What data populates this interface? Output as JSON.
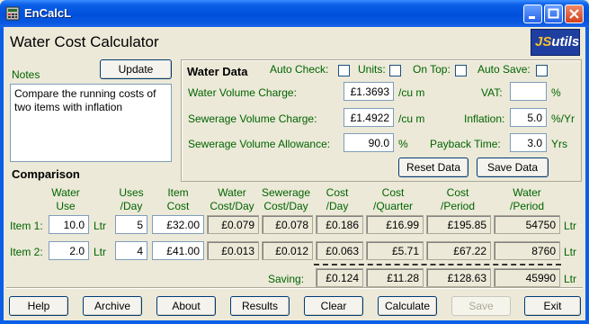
{
  "window": {
    "title": "EnCalcL"
  },
  "app": {
    "title": "Water Cost Calculator",
    "logo_j": "JS",
    "logo_rest": "utils"
  },
  "notes": {
    "label": "Notes",
    "update_label": "Update",
    "text": "Compare the running costs of two items with inflation"
  },
  "water_data": {
    "heading": "Water Data",
    "auto_check": "Auto Check:",
    "units": "Units:",
    "on_top": "On Top:",
    "auto_save": "Auto Save:",
    "water_charge_label": "Water Volume Charge:",
    "water_charge": "£1.3693",
    "water_charge_unit": "/cu m",
    "sewer_charge_label": "Sewerage Volume Charge:",
    "sewer_charge": "£1.4922",
    "sewer_charge_unit": "/cu m",
    "sewer_allow_label": "Sewerage Volume Allowance:",
    "sewer_allow": "90.0",
    "sewer_allow_unit": "%",
    "vat_label": "VAT:",
    "vat": "",
    "vat_unit": "%",
    "inflation_label": "Inflation:",
    "inflation": "5.0",
    "inflation_unit": "%/Yr",
    "payback_label": "Payback Time:",
    "payback": "3.0",
    "payback_unit": "Yrs",
    "reset_label": "Reset Data",
    "save_label": "Save Data"
  },
  "comparison": {
    "heading": "Comparison",
    "headers": {
      "water_use": [
        "Water",
        "Use"
      ],
      "uses_day": [
        "Uses",
        "/Day"
      ],
      "item_cost": [
        "Item",
        "Cost"
      ],
      "water_cost_day": [
        "Water",
        "Cost/Day"
      ],
      "sewer_cost_day": [
        "Sewerage",
        "Cost/Day"
      ],
      "cost_day": [
        "Cost",
        "/Day"
      ],
      "cost_quarter": [
        "Cost",
        "/Quarter"
      ],
      "cost_period": [
        "Cost",
        "/Period"
      ],
      "water_period": [
        "Water",
        "/Period"
      ]
    },
    "unit": "Ltr",
    "items": [
      {
        "label": "Item 1:",
        "water_use": "10.0",
        "uses": "5",
        "cost": "£32.00",
        "water_cost": "£0.079",
        "sewer_cost": "£0.078",
        "cost_day": "£0.186",
        "cost_quarter": "£16.99",
        "cost_period": "£195.85",
        "water_period": "54750"
      },
      {
        "label": "Item 2:",
        "water_use": "2.0",
        "uses": "4",
        "cost": "£41.00",
        "water_cost": "£0.013",
        "sewer_cost": "£0.012",
        "cost_day": "£0.063",
        "cost_quarter": "£5.71",
        "cost_period": "£67.22",
        "water_period": "8760"
      }
    ],
    "saving": {
      "label": "Saving:",
      "cost_day": "£0.124",
      "cost_quarter": "£11.28",
      "cost_period": "£128.63",
      "water_period": "45990"
    }
  },
  "toolbar": [
    "Help",
    "Archive",
    "About",
    "Results",
    "Clear",
    "Calculate",
    "Save",
    "Exit"
  ],
  "colors": {
    "titlebar": "#0050dc",
    "background": "#ece9d8",
    "label_green": "#006400"
  },
  "icons": {
    "app": "calculator-icon",
    "minimize": "minimize-icon",
    "maximize": "maximize-icon",
    "close": "close-icon"
  }
}
